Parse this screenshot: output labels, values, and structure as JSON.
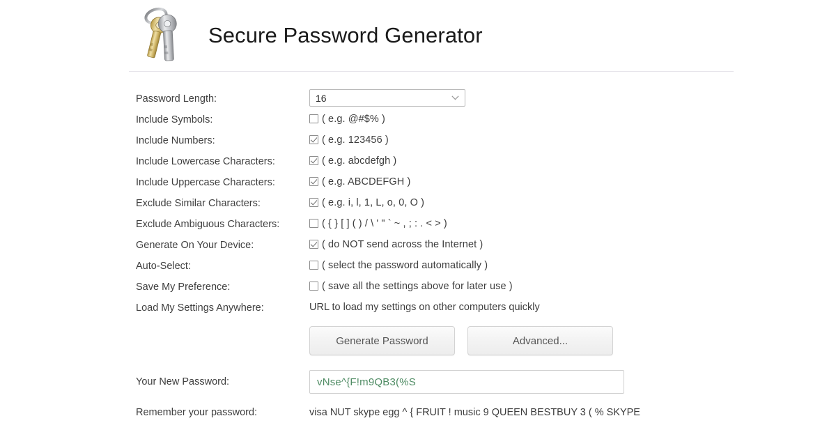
{
  "header": {
    "title": "Secure Password Generator",
    "icon": "keys-icon"
  },
  "form": {
    "rows": [
      {
        "label": "Password Length:",
        "type": "select",
        "value": "16",
        "icon": "chevron-down-icon"
      },
      {
        "label": "Include Symbols:",
        "type": "checkbox",
        "checked": false,
        "hint": "( e.g. @#$% )"
      },
      {
        "label": "Include Numbers:",
        "type": "checkbox",
        "checked": true,
        "hint": "( e.g. 123456 )"
      },
      {
        "label": "Include Lowercase Characters:",
        "type": "checkbox",
        "checked": true,
        "hint": "( e.g. abcdefgh )"
      },
      {
        "label": "Include Uppercase Characters:",
        "type": "checkbox",
        "checked": true,
        "hint": "( e.g. ABCDEFGH )"
      },
      {
        "label": "Exclude Similar Characters:",
        "type": "checkbox",
        "checked": true,
        "hint": "( e.g. i, l, 1, L, o, 0, O )"
      },
      {
        "label": "Exclude Ambiguous Characters:",
        "type": "checkbox",
        "checked": false,
        "hint": "( { } [ ] ( ) / \\ ' \" ` ~ , ; : . < > )"
      },
      {
        "label": "Generate On Your Device:",
        "type": "checkbox",
        "checked": true,
        "hint": "( do NOT send across the Internet )"
      },
      {
        "label": "Auto-Select:",
        "type": "checkbox",
        "checked": false,
        "hint": "( select the password automatically )"
      },
      {
        "label": "Save My Preference:",
        "type": "checkbox",
        "checked": false,
        "hint": "( save all the settings above for later use )"
      },
      {
        "label": "Load My Settings Anywhere:",
        "type": "text",
        "hint": "URL to load my settings on other computers quickly"
      }
    ]
  },
  "buttons": {
    "generate_label": "Generate Password",
    "advanced_label": "Advanced..."
  },
  "output": {
    "password_label": "Your New Password:",
    "password_value": "vNse^{F!m9QB3(%S",
    "remember_label": "Remember your password:",
    "remember_value": "visa NUT skype egg ^ { FRUIT ! music 9 QUEEN BESTBUY 3 ( % SKYPE"
  },
  "colors": {
    "password_text": "#4e8b63",
    "label_text": "#3f3f3f",
    "divider": "#e6e4ea"
  }
}
